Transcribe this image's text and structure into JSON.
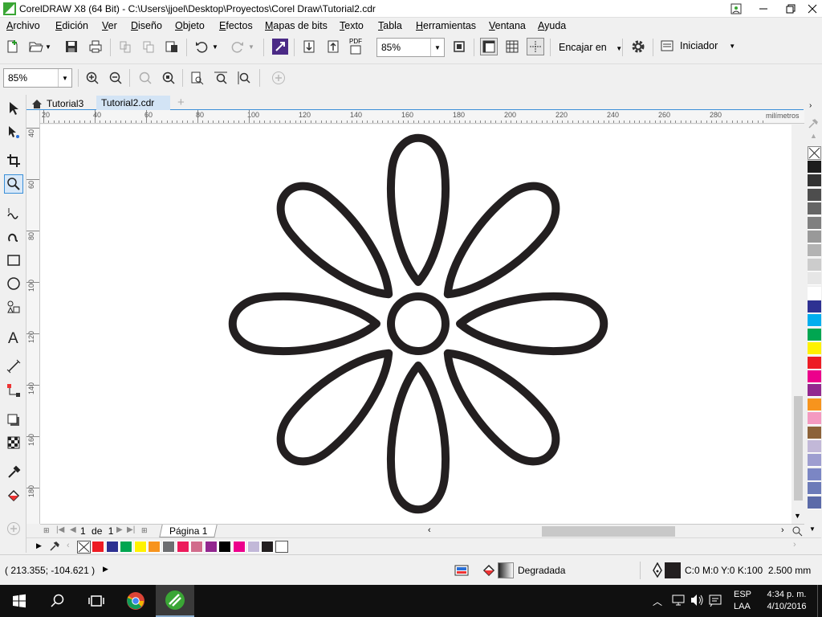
{
  "window": {
    "title": "CorelDRAW X8 (64 Bit) - C:\\Users\\jjoel\\Desktop\\Proyectos\\Corel Draw\\Tutorial2.cdr"
  },
  "menu": [
    {
      "label": "Archivo"
    },
    {
      "label": "Edición"
    },
    {
      "label": "Ver"
    },
    {
      "label": "Diseño"
    },
    {
      "label": "Objeto"
    },
    {
      "label": "Efectos"
    },
    {
      "label": "Mapas de bits"
    },
    {
      "label": "Texto"
    },
    {
      "label": "Tabla"
    },
    {
      "label": "Herramientas"
    },
    {
      "label": "Ventana"
    },
    {
      "label": "Ayuda"
    }
  ],
  "toolbar": {
    "zoom_value": "85%",
    "snap_label": "Encajar en",
    "launcher_label": "Iniciador",
    "pdf_label": "PDF"
  },
  "property_bar": {
    "zoom_value": "85%"
  },
  "tabs": [
    {
      "label": "Tutorial3",
      "icon": "home-icon"
    },
    {
      "label": "Tutorial2.cdr",
      "active": true
    }
  ],
  "ruler": {
    "h_ticks": [
      "20",
      "40",
      "60",
      "80",
      "100",
      "120",
      "140",
      "160",
      "180",
      "200",
      "220",
      "240",
      "260",
      "280"
    ],
    "unit": "milímetros",
    "v_ticks": [
      "40",
      "60",
      "80",
      "100",
      "120",
      "140",
      "160",
      "180"
    ]
  },
  "page_nav": {
    "current": "1",
    "of": "de",
    "total": "1",
    "page_tab": "Página 1"
  },
  "status": {
    "coords": "( 213.355; -104.621 )",
    "fill_label": "Degradada",
    "outline_label": "C:0 M:0 Y:0 K:100  2.500 mm"
  },
  "taskbar": {
    "lang": "ESP",
    "lang_sub": "LAA",
    "time": "4:34 p. m.",
    "date": "4/10/2016"
  },
  "colors": {
    "accent": "#3a8fd8",
    "flower_stroke": "#231f20"
  },
  "palette_right": [
    "#1c1c1c",
    "#333333",
    "#4d4d4d",
    "#666666",
    "#808080",
    "#999999",
    "#b3b3b3",
    "#cccccc",
    "#e6e6e6",
    "#ffffff",
    "#2e3192",
    "#00aeef",
    "#00a651",
    "#fff200",
    "#ed1c24",
    "#ec008c",
    "#92278f",
    "#f7941d",
    "#f49ac1",
    "#8c6239",
    "#c2b8d8",
    "#9e9ed0",
    "#7b86c4",
    "#6c7bb8",
    "#5b6aa8"
  ],
  "palette_doc": [
    "#ed1c24",
    "#2e3192",
    "#00a651",
    "#fff200",
    "#f7941d",
    "#6d6e71",
    "#ec1c5c",
    "#d16c8c",
    "#92278f",
    "#000000",
    "#ec008c",
    "#c2b8d8",
    "#231f20",
    "#ffffff"
  ]
}
